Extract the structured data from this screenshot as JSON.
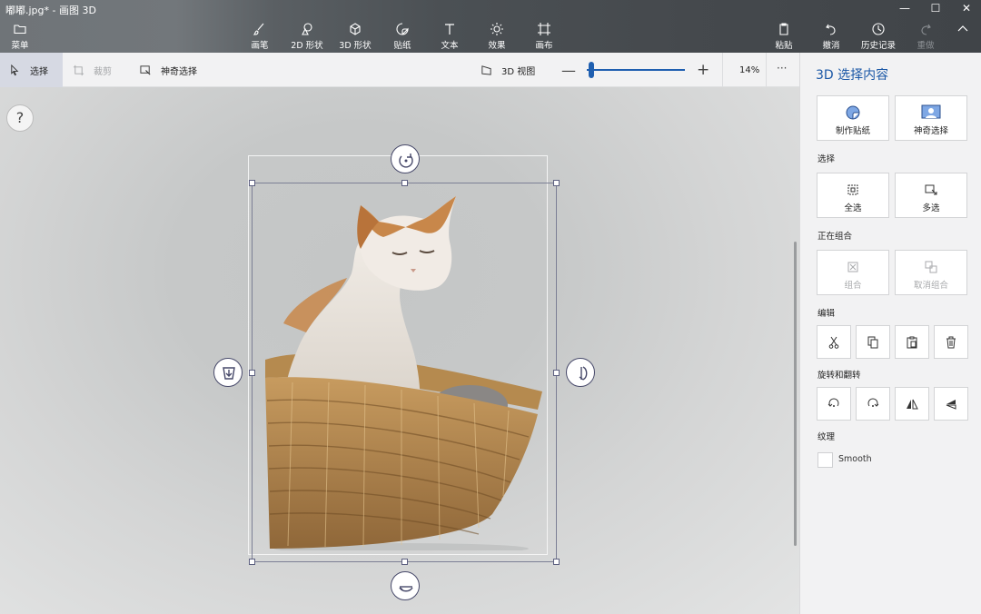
{
  "window": {
    "title": "嘟嘟.jpg* - 画图 3D",
    "controls": [
      "minimize-icon",
      "maximize-icon",
      "close-icon"
    ]
  },
  "toolbar": {
    "menu": "菜单",
    "tools": [
      {
        "label": "画笔",
        "icon": "brush-icon"
      },
      {
        "label": "2D 形状",
        "icon": "2d-shapes-icon"
      },
      {
        "label": "3D 形状",
        "icon": "3d-shapes-icon"
      },
      {
        "label": "贴纸",
        "icon": "sticker-icon"
      },
      {
        "label": "文本",
        "icon": "text-icon"
      },
      {
        "label": "效果",
        "icon": "effects-icon"
      },
      {
        "label": "画布",
        "icon": "canvas-icon"
      }
    ],
    "right": [
      {
        "label": "粘贴",
        "icon": "paste-icon"
      },
      {
        "label": "撤消",
        "icon": "undo-icon"
      },
      {
        "label": "历史记录",
        "icon": "history-icon"
      },
      {
        "label": "重做",
        "icon": "redo-icon",
        "disabled": true
      }
    ]
  },
  "subbar": {
    "select": "选择",
    "crop": "裁剪",
    "magic_select": "神奇选择",
    "view3d": "3D 视图",
    "zoom_percent": "14%",
    "zoom_level": 0.04,
    "more": "···"
  },
  "canvas": {
    "help": "?"
  },
  "panel": {
    "title": "3D 选择内容",
    "top_buttons": [
      {
        "label": "制作贴纸",
        "icon": "make-sticker-icon"
      },
      {
        "label": "神奇选择",
        "icon": "magic-select-icon"
      }
    ],
    "select_label": "选择",
    "select_buttons": [
      {
        "label": "全选",
        "icon": "select-all-icon"
      },
      {
        "label": "多选",
        "icon": "multi-select-icon"
      }
    ],
    "group_label": "正在组合",
    "group_buttons": [
      {
        "label": "组合",
        "icon": "group-icon"
      },
      {
        "label": "取消组合",
        "icon": "ungroup-icon"
      }
    ],
    "edit_label": "编辑",
    "edit_icons": [
      "cut-icon",
      "copy-icon",
      "paste-icon",
      "delete-icon"
    ],
    "rotate_label": "旋转和翻转",
    "rotate_icons": [
      "rotate-left-icon",
      "rotate-right-icon",
      "flip-horizontal-icon",
      "flip-vertical-icon"
    ],
    "texture_label": "纹理",
    "smooth_label": "Smooth",
    "accent": "#1a57a6"
  }
}
